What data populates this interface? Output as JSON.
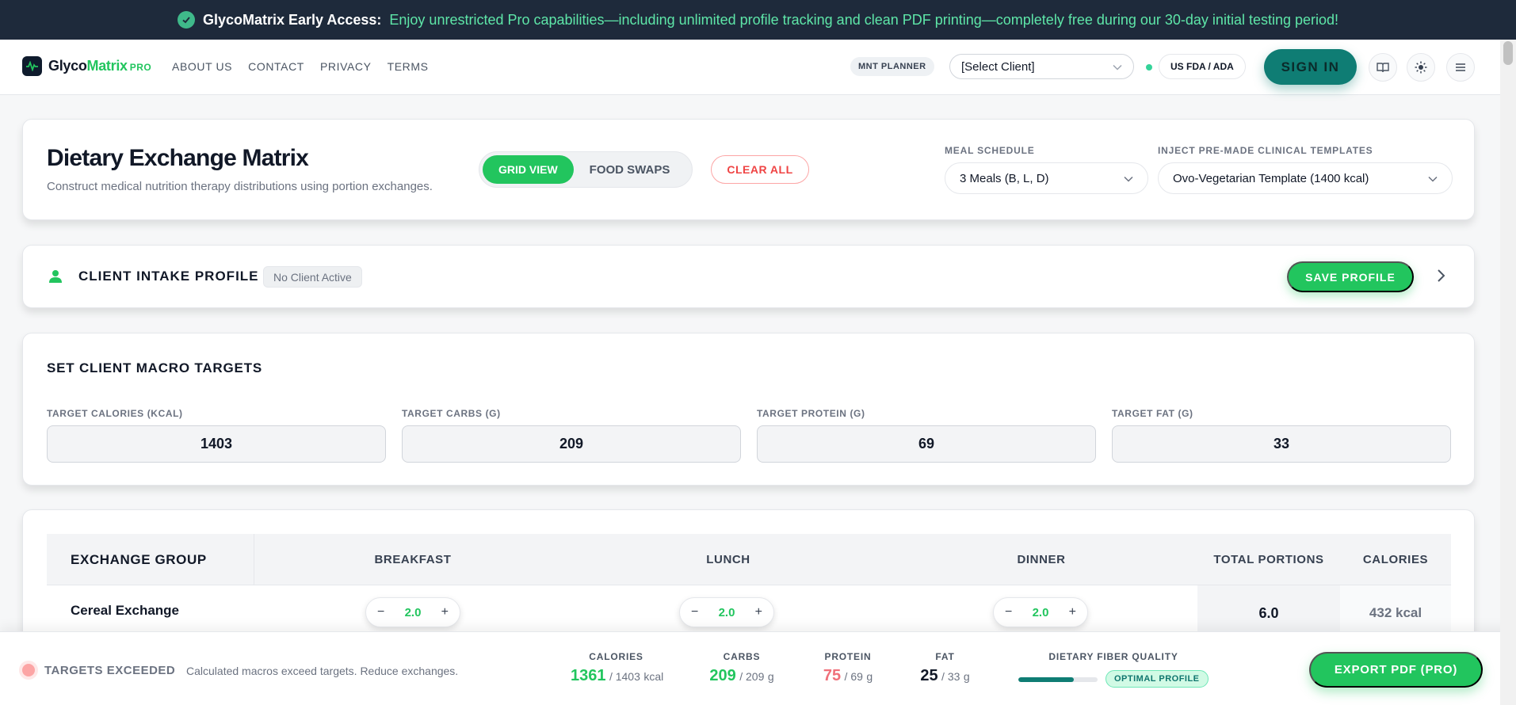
{
  "banner": {
    "lead": "GlycoMatrix Early Access:",
    "message": "Enjoy unrestricted Pro capabilities—including unlimited profile tracking and clean PDF printing—completely free during our 30-day initial testing period!"
  },
  "nav": {
    "logo": {
      "glyco": "Glyco",
      "matrix": "Matrix",
      "pro": "PRO"
    },
    "links": [
      "ABOUT US",
      "CONTACT",
      "PRIVACY",
      "TERMS"
    ],
    "mnt_badge": "MNT PLANNER",
    "client_select": "[Select Client]",
    "region": "US FDA / ADA",
    "sign_in": "SIGN IN"
  },
  "header_card": {
    "title": "Dietary Exchange Matrix",
    "subtitle": "Construct medical nutrition therapy distributions using portion exchanges.",
    "view_toggle": {
      "active": "GRID VIEW",
      "inactive": "FOOD SWAPS"
    },
    "clear_all": "CLEAR ALL",
    "meal_schedule": {
      "label": "MEAL SCHEDULE",
      "value": "3 Meals (B, L, D)"
    },
    "templates": {
      "label": "INJECT PRE-MADE CLINICAL TEMPLATES",
      "value": "Ovo-Vegetarian Template (1400 kcal)"
    }
  },
  "intake": {
    "title": "CLIENT INTAKE PROFILE",
    "status": "No Client Active",
    "save": "SAVE PROFILE"
  },
  "macros": {
    "title": "SET CLIENT MACRO TARGETS",
    "fields": [
      {
        "label": "TARGET CALORIES (KCAL)",
        "value": "1403"
      },
      {
        "label": "TARGET CARBS (G)",
        "value": "209"
      },
      {
        "label": "TARGET PROTEIN (G)",
        "value": "69"
      },
      {
        "label": "TARGET FAT (G)",
        "value": "33"
      }
    ]
  },
  "table": {
    "headers": {
      "group": "EXCHANGE GROUP",
      "breakfast": "BREAKFAST",
      "lunch": "LUNCH",
      "dinner": "DINNER",
      "total": "TOTAL PORTIONS",
      "calories": "CALORIES"
    },
    "rows": [
      {
        "name": "Cereal Exchange",
        "breakfast": "2.0",
        "lunch": "2.0",
        "dinner": "2.0",
        "total": "6.0",
        "calories": "432 kcal"
      }
    ],
    "minus": "−",
    "plus": "+"
  },
  "footer": {
    "warning_title": "TARGETS EXCEEDED",
    "warning_msg": "Calculated macros exceed targets. Reduce exchanges.",
    "stats": {
      "calories": {
        "label": "CALORIES",
        "current": "1361",
        "target": "/ 1403",
        "unit": "kcal",
        "color": "#22c55e"
      },
      "carbs": {
        "label": "CARBS",
        "current": "209",
        "target": "/ 209",
        "unit": "g",
        "color": "#22c55e"
      },
      "protein": {
        "label": "PROTEIN",
        "current": "75",
        "target": "/ 69",
        "unit": "g",
        "color": "#f0707a"
      },
      "fat": {
        "label": "FAT",
        "current": "25",
        "target": "/ 33",
        "unit": "g",
        "color": "#111827"
      }
    },
    "fiber": {
      "label": "DIETARY FIBER QUALITY",
      "badge": "OPTIMAL PROFILE",
      "level": 0.7
    },
    "export": "EXPORT PDF (PRO)"
  },
  "colors": {
    "accent": "#22c55e",
    "teal": "#0f7d74",
    "danger": "#ef4444",
    "banner_bg": "#1e2a3b"
  },
  "icons": [
    "check-circle-icon",
    "pulse-logo-icon",
    "chevron-down-icon",
    "book-icon",
    "sun-icon",
    "menu-icon",
    "user-icon",
    "chevron-right-icon"
  ]
}
